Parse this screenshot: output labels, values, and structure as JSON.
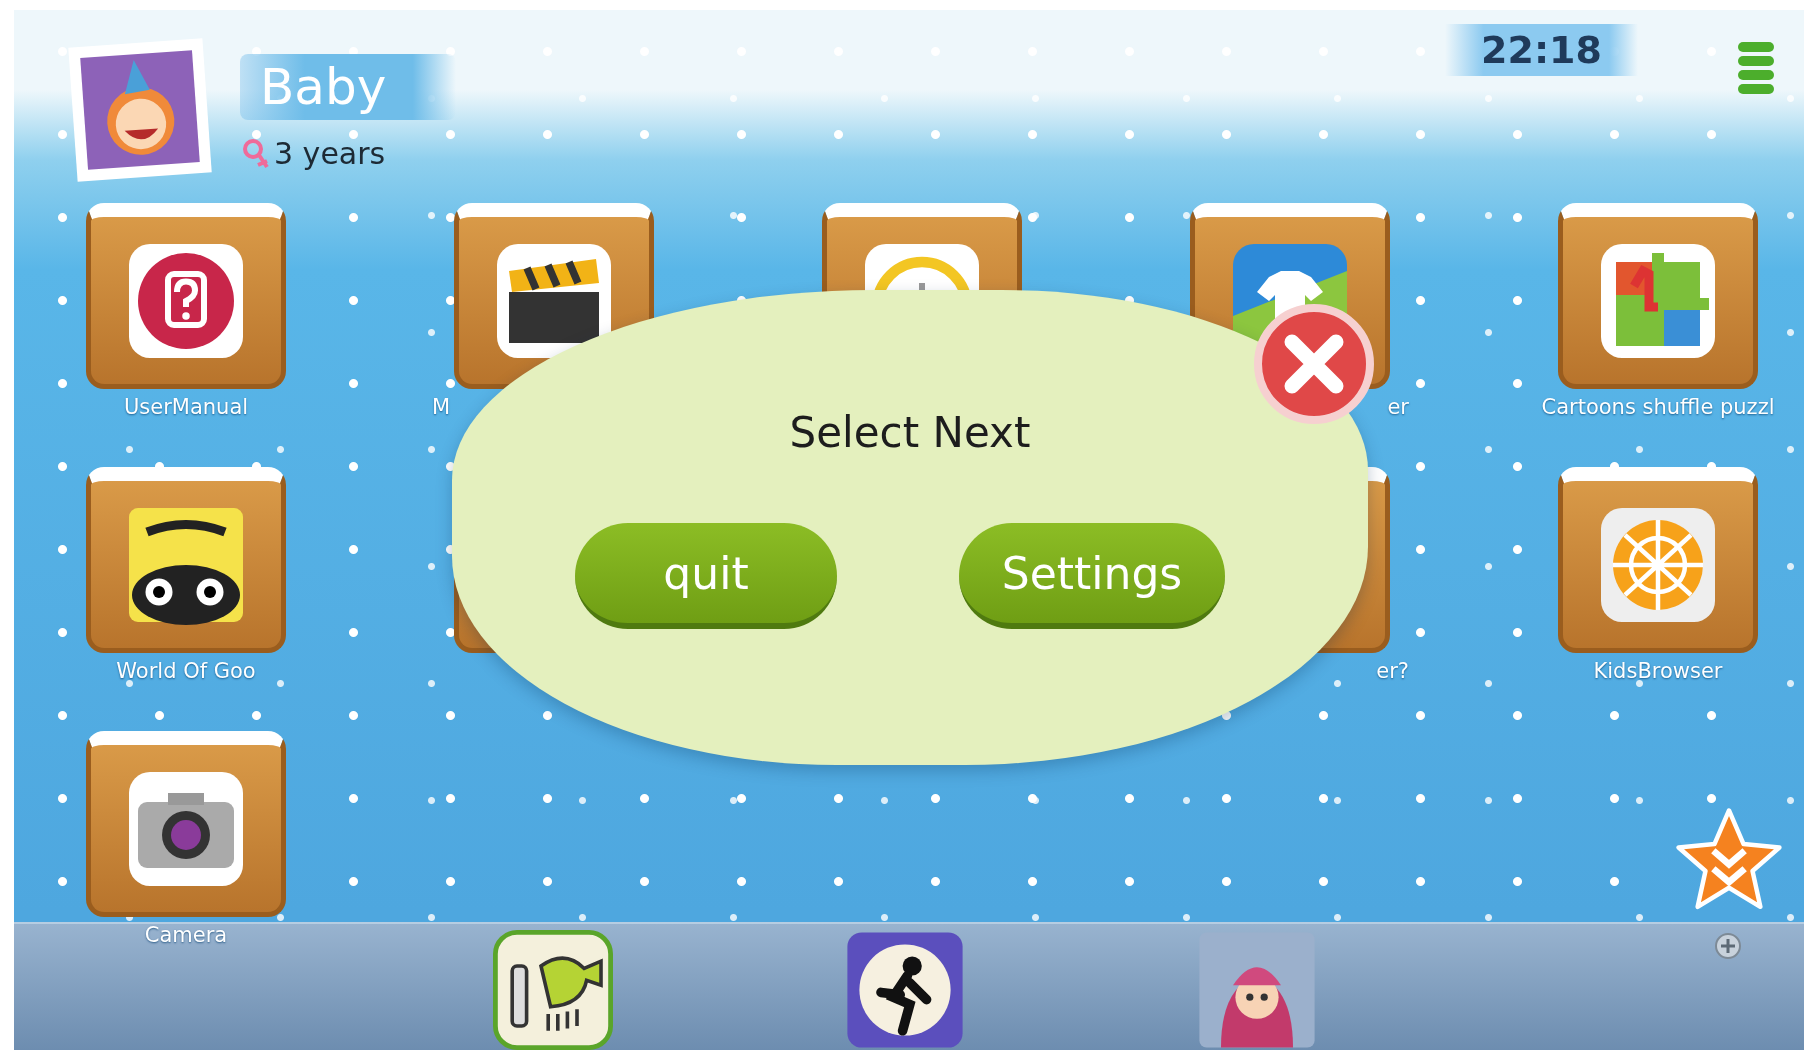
{
  "profile": {
    "name": "Baby",
    "age": "3 years"
  },
  "clock": "22:18",
  "apps": [
    {
      "kind": "help",
      "label": "UserManual"
    },
    {
      "kind": "clapper",
      "label": "M"
    },
    {
      "kind": "clock"
    },
    {
      "kind": "shirt",
      "label": "er"
    },
    {
      "kind": "puzzle",
      "label": "Cartoons shuffle puzzl"
    },
    {
      "kind": "goo",
      "label": "World Of Goo"
    },
    {
      "kind": "blank"
    },
    {
      "kind": "empty"
    },
    {
      "kind": "blank",
      "label": "er?"
    },
    {
      "kind": "globe",
      "label": "KidsBrowser"
    },
    {
      "kind": "camera",
      "label": "Camera"
    }
  ],
  "dock": [
    {
      "kind": "doodle"
    },
    {
      "kind": "runner"
    },
    {
      "kind": "cartoon"
    }
  ],
  "dialog": {
    "title": "Select Next",
    "buttons": [
      "quit",
      "Settings"
    ]
  }
}
